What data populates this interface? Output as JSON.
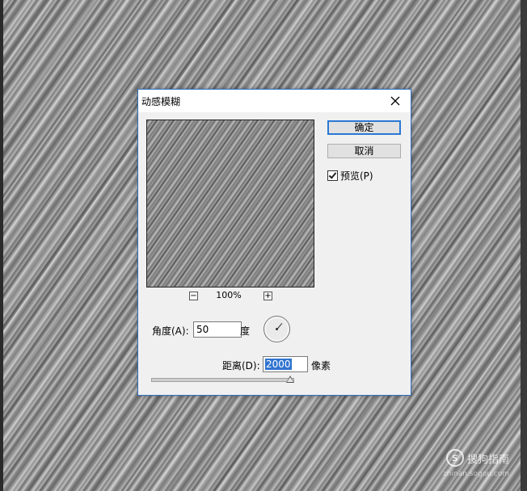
{
  "dialog": {
    "title": "动感模糊",
    "ok_label": "确定",
    "cancel_label": "取消",
    "preview_label": "预览(P)",
    "preview_checked": true,
    "zoom_minus": "−",
    "zoom_plus": "+",
    "zoom_level": "100%",
    "angle_label": "角度(A):",
    "angle_value": "50",
    "angle_unit": "度",
    "distance_label": "距离(D):",
    "distance_value": "2000",
    "distance_unit": "像素",
    "distance_slider_fraction": 1.0
  },
  "watermark": {
    "text": "搜狗指南",
    "url": "zhinan.sogou.com"
  },
  "icons": [
    "close-icon",
    "checkbox-icon",
    "angle-dial-icon",
    "zoom-minus-icon",
    "zoom-plus-icon"
  ],
  "colors": {
    "accent": "#2a78d4",
    "selection": "#3174d0",
    "dialog_bg": "#f0f0f0"
  }
}
